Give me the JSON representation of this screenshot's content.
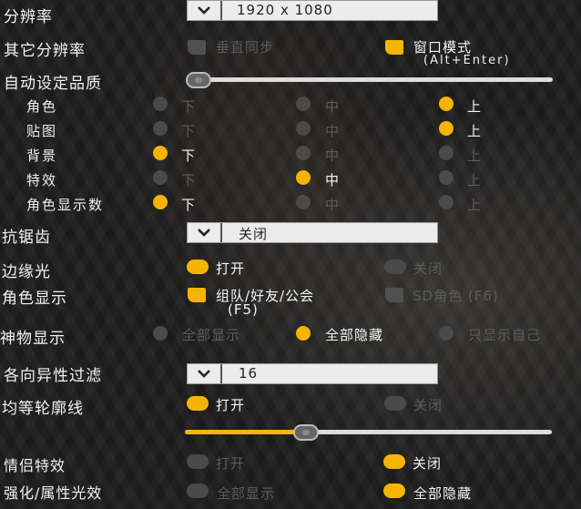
{
  "settings": {
    "resolution": {
      "label": "分辨率",
      "value": "1920 x 1080"
    },
    "other_resolution": {
      "label": "其它分辨率",
      "vsync": "垂直同步",
      "window_mode": "窗口模式",
      "window_mode_hint": "(Alt+Enter)"
    },
    "auto_quality": {
      "label": "自动设定品质",
      "slider_value": 0
    },
    "quality_levels": {
      "low": "下",
      "mid": "中",
      "high": "上"
    },
    "quality_rows": [
      {
        "label": "角色",
        "selected": "上"
      },
      {
        "label": "贴图",
        "selected": "上"
      },
      {
        "label": "背景",
        "selected": "下"
      },
      {
        "label": "特效",
        "selected": "中"
      },
      {
        "label": "角色显示数",
        "selected": "下"
      }
    ],
    "antialias": {
      "label": "抗锯齿",
      "value": "关闭"
    },
    "rim_light": {
      "label": "边缘光",
      "on": "打开",
      "off": "关闭",
      "selected": "打开"
    },
    "char_display": {
      "label": "角色显示",
      "party": "组队/好友/公会",
      "party_hint": "(F5)",
      "sd": "SD角色 (F6)",
      "party_checked": true,
      "sd_checked": false
    },
    "artifact_display": {
      "label": "神物显示",
      "all_show": "全部显示",
      "all_hide": "全部隐藏",
      "self_only": "只显示自己",
      "selected": "全部隐藏"
    },
    "anisotropic": {
      "label": "各向异性过滤",
      "value": "16"
    },
    "outline": {
      "label": "均等轮廓线",
      "on": "打开",
      "off": "关闭",
      "selected": "打开",
      "slider_value": 0.33
    },
    "couple_effect": {
      "label": "情侣特效",
      "on": "打开",
      "off": "关闭",
      "selected": "关闭"
    },
    "enhance_effect": {
      "label": "强化/属性光效",
      "all_show": "全部显示",
      "all_hide": "全部隐藏",
      "selected": "全部隐藏"
    }
  },
  "icons": {
    "dropdown": "chevron-down-icon"
  },
  "colors": {
    "accent": "#f5b400",
    "inactive": "#4a4a4a"
  }
}
